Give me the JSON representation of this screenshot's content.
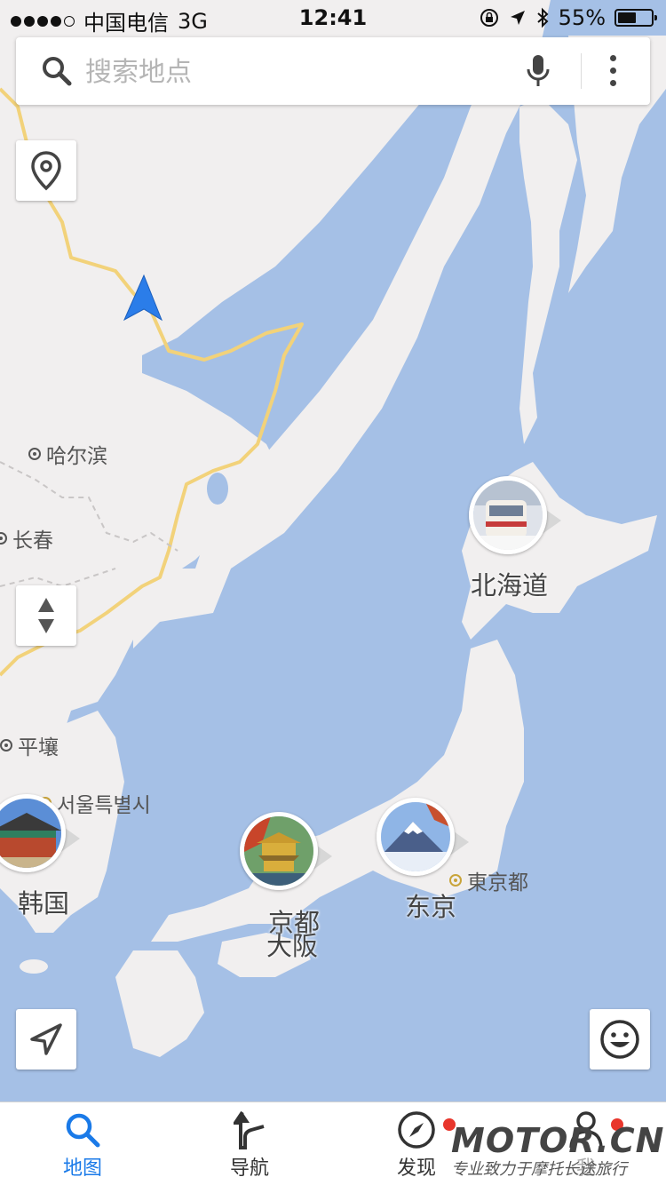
{
  "status_bar": {
    "carrier": "中国电信",
    "network": "3G",
    "time": "12:41",
    "battery_percent": "55%",
    "battery_level": 0.55
  },
  "search": {
    "placeholder": "搜索地点"
  },
  "map": {
    "cities": {
      "harbin": "哈尔滨",
      "changchun": "长春",
      "pyongyang": "平壤",
      "seoul": "서울특별시",
      "tokyo_metro": "東京都"
    },
    "destinations": {
      "hokkaido": "北海道",
      "korea": "韩国",
      "kyoto": "京都",
      "osaka": "大阪",
      "tokyo": "东京"
    }
  },
  "tabs": [
    {
      "label": "地图",
      "icon": "search-icon",
      "active": true
    },
    {
      "label": "导航",
      "icon": "turn-arrow-icon"
    },
    {
      "label": "发现",
      "icon": "compass-icon",
      "badge": true
    },
    {
      "label": "我",
      "icon": "person-icon",
      "badge": true
    }
  ],
  "watermark": {
    "logo": "MOTOR.CN",
    "slogan": "专业致力于摩托长途旅行"
  },
  "colors": {
    "sea": "#a5c0e6",
    "land": "#f1efef",
    "border": "#f2d27a",
    "accent": "#1a7ae8",
    "badge": "#e8362c"
  }
}
